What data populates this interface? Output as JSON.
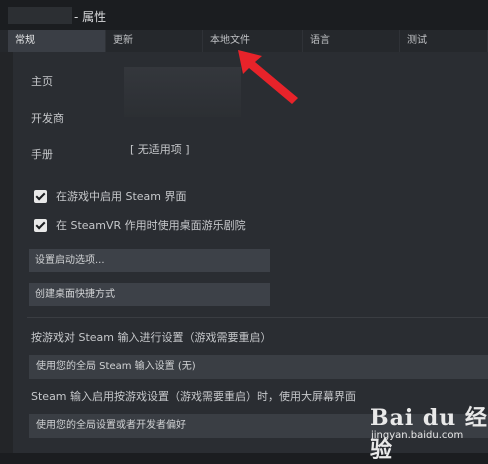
{
  "window": {
    "title": "- 属性"
  },
  "tabs": [
    {
      "label": "常规",
      "active": true
    },
    {
      "label": "更新"
    },
    {
      "label": "本地文件"
    },
    {
      "label": "语言"
    },
    {
      "label": "测试"
    }
  ],
  "general": {
    "homepage_label": "主页",
    "developer_label": "开发商",
    "manual_label": "手册",
    "manual_value": "[ 无适用项 ]",
    "overlay_label": "在游戏中启用 Steam 界面",
    "overlay_checked": true,
    "steamvr_label": "在 SteamVR 作用时使用桌面游乐剧院",
    "steamvr_checked": true,
    "launch_options_button": "设置启动选项...",
    "shortcut_button": "创建桌面快捷方式",
    "input_section_label": "按游戏对 Steam 输入进行设置（游戏需要重启）",
    "input_select_value": "使用您的全局 Steam 输入设置 (无)",
    "bigpicture_section_label": "Steam 输入启用按游戏设置（游戏需要重启）时，使用大屏幕界面",
    "bigpicture_select_value": "使用您的全局设置或者开发者偏好"
  },
  "watermark": {
    "text": "Bai du 经验",
    "sub": "jingyan.baidu.com"
  },
  "colors": {
    "arrow": "#e8232a",
    "background": "#1b1d20",
    "panel": "#2a2d32"
  }
}
